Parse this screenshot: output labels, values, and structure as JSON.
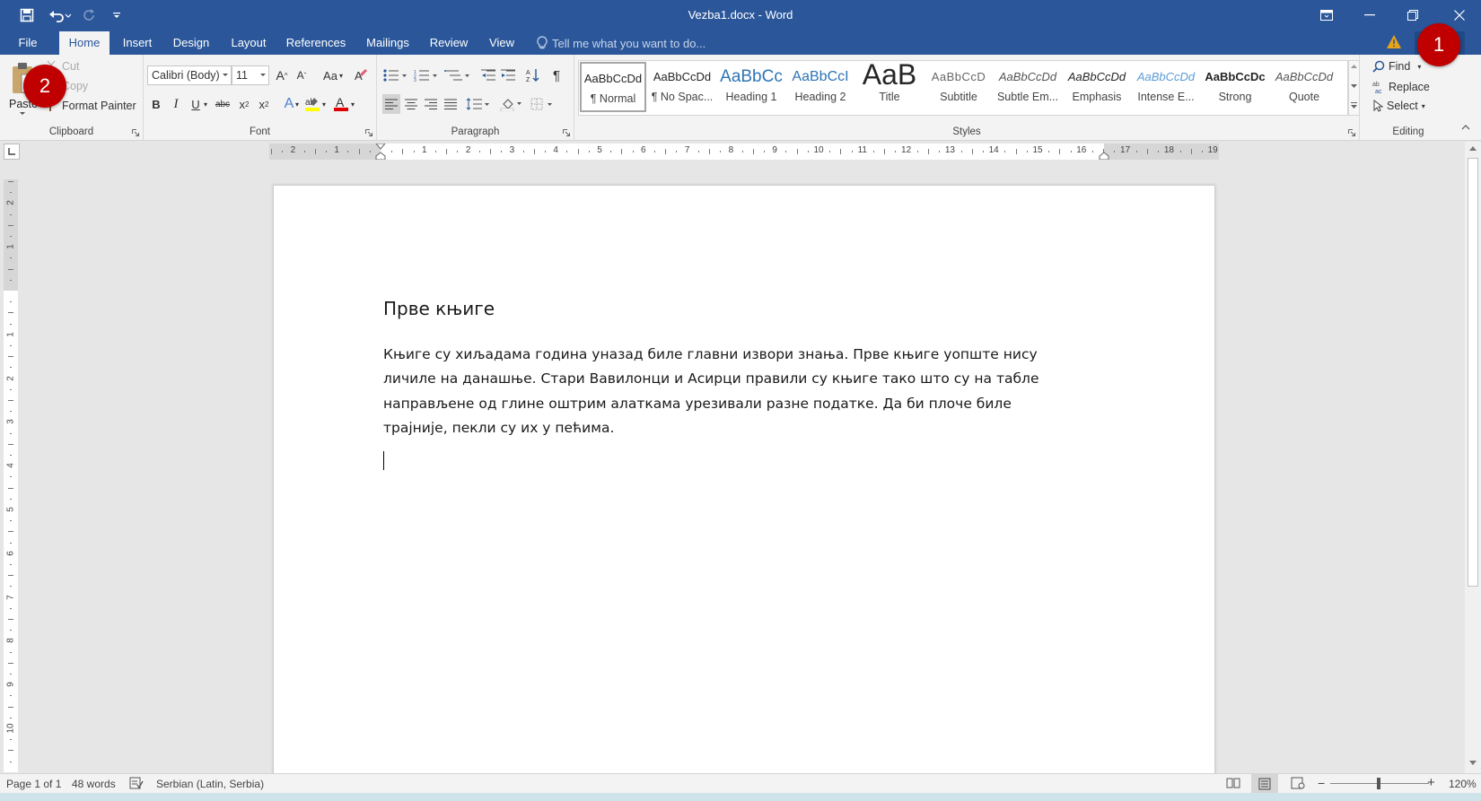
{
  "window": {
    "title": "Vezba1.docx - Word"
  },
  "tabs": [
    {
      "label": "File"
    },
    {
      "label": "Home"
    },
    {
      "label": "Insert"
    },
    {
      "label": "Design"
    },
    {
      "label": "Layout"
    },
    {
      "label": "References"
    },
    {
      "label": "Mailings"
    },
    {
      "label": "Review"
    },
    {
      "label": "View"
    }
  ],
  "tell_me": {
    "placeholder": "Tell me what you want to do..."
  },
  "clipboard": {
    "paste": "Paste",
    "cut": "Cut",
    "copy": "Copy",
    "format_painter": "Format Painter",
    "label": "Clipboard"
  },
  "font": {
    "name": "Calibri (Body)",
    "size": "11",
    "change_case": "Aa",
    "label": "Font"
  },
  "paragraph": {
    "label": "Paragraph"
  },
  "styles": {
    "label": "Styles",
    "items": [
      {
        "preview": "AaBbCcDd",
        "name": "¶ Normal"
      },
      {
        "preview": "AaBbCcDd",
        "name": "¶ No Spac..."
      },
      {
        "preview": "AaBbCc",
        "name": "Heading 1"
      },
      {
        "preview": "AaBbCcI",
        "name": "Heading 2"
      },
      {
        "preview": "AaB",
        "name": "Title"
      },
      {
        "preview": "AaBbCcD",
        "name": "Subtitle"
      },
      {
        "preview": "AaBbCcDd",
        "name": "Subtle Em..."
      },
      {
        "preview": "AaBbCcDd",
        "name": "Emphasis"
      },
      {
        "preview": "AaBbCcDd",
        "name": "Intense E..."
      },
      {
        "preview": "AaBbCcDc",
        "name": "Strong"
      },
      {
        "preview": "AaBbCcDd",
        "name": "Quote"
      }
    ]
  },
  "editing": {
    "find": "Find",
    "replace": "Replace",
    "select": "Select",
    "label": "Editing"
  },
  "ruler": {
    "h_ticks": [
      "2",
      "1",
      "1",
      "2",
      "3",
      "4",
      "5",
      "6",
      "7",
      "8",
      "9",
      "10",
      "11",
      "12",
      "13",
      "14",
      "15",
      "16",
      "17",
      "18",
      "19"
    ],
    "v_ticks": [
      "2",
      "1",
      "1",
      "2",
      "3",
      "4",
      "5",
      "6",
      "7",
      "8",
      "9",
      "10",
      "11"
    ]
  },
  "document": {
    "heading": "Прве књиге",
    "paragraph_lines": [
      "Књиге су хиљадама година уназад биле главни извори знања. Прве књиге уопште нису",
      "личиле на данашње. Стари Вавилонци и Асирци правили су књиге тако што су на табле",
      "направљене од глине оштрим алаткама урезивали разне податке. Да би плоче биле",
      "трајније, пекли су их у пећима."
    ]
  },
  "status": {
    "page": "Page 1 of 1",
    "words": "48 words",
    "language": "Serbian (Latin, Serbia)",
    "zoom": "120%"
  },
  "annotations": [
    {
      "label": "1"
    },
    {
      "label": "2"
    }
  ],
  "colors": {
    "accent": "#2b579a",
    "badge": "#c00000"
  }
}
